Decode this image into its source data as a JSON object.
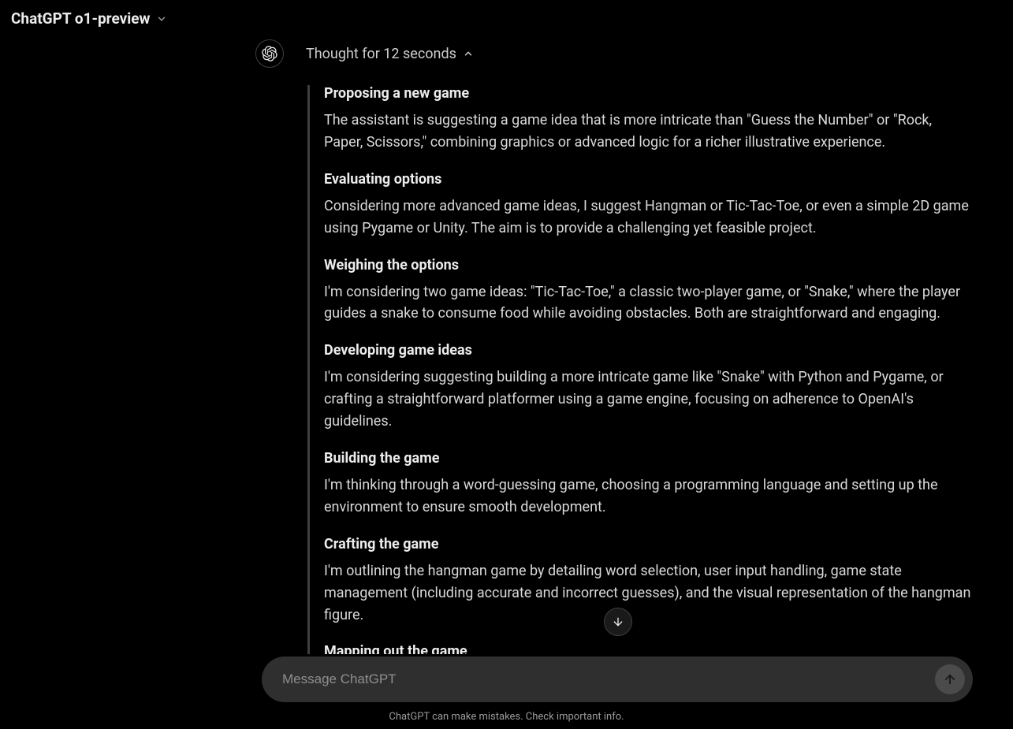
{
  "header": {
    "title": "ChatGPT o1-preview"
  },
  "thought": {
    "label": "Thought for 12 seconds"
  },
  "steps": [
    {
      "title": "Proposing a new game",
      "body": "The assistant is suggesting a game idea that is more intricate than \"Guess the Number\" or \"Rock, Paper, Scissors,\" combining graphics or advanced logic for a richer illustrative experience."
    },
    {
      "title": "Evaluating options",
      "body": "Considering more advanced game ideas, I suggest Hangman or Tic-Tac-Toe, or even a simple 2D game using Pygame or Unity. The aim is to provide a challenging yet feasible project."
    },
    {
      "title": "Weighing the options",
      "body": "I'm considering two game ideas: \"Tic-Tac-Toe,\" a classic two-player game, or \"Snake,\" where the player guides a snake to consume food while avoiding obstacles. Both are straightforward and engaging."
    },
    {
      "title": "Developing game ideas",
      "body": "I'm considering suggesting building a more intricate game like \"Snake\" with Python and Pygame, or crafting a straightforward platformer using a game engine, focusing on adherence to OpenAI's guidelines."
    },
    {
      "title": "Building the game",
      "body": "I'm thinking through a word-guessing game, choosing a programming language and setting up the environment to ensure smooth development."
    },
    {
      "title": "Crafting the game",
      "body": "I'm outlining the hangman game by detailing word selection, user input handling, game state management (including accurate and incorrect guesses), and the visual representation of the hangman figure."
    },
    {
      "title": "Mapping out the game",
      "body": ""
    }
  ],
  "composer": {
    "placeholder": "Message ChatGPT"
  },
  "footer": {
    "text": "ChatGPT can make mistakes. Check important info."
  }
}
